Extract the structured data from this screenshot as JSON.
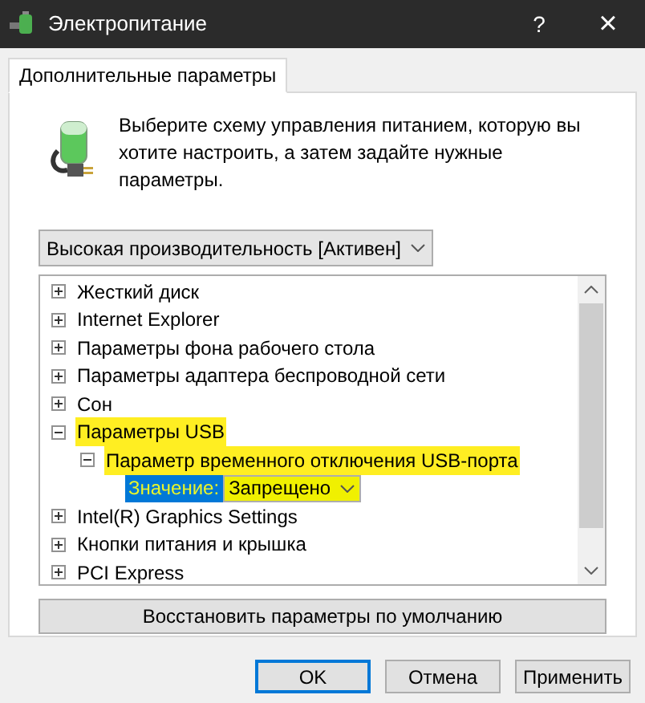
{
  "window": {
    "title": "Электропитание",
    "help": "?",
    "close": "×"
  },
  "tabs": [
    {
      "label": "Дополнительные параметры",
      "selected": true
    }
  ],
  "description": "Выберите схему управления питанием, которую вы хотите настроить, а затем задайте нужные параметры.",
  "plan_dropdown": {
    "value": "Высокая производительность [Активен]"
  },
  "tree": [
    {
      "label": "Жесткий диск",
      "expanded": false,
      "highlighted": false
    },
    {
      "label": "Internet Explorer",
      "expanded": false,
      "highlighted": false
    },
    {
      "label": "Параметры фона рабочего стола",
      "expanded": false,
      "highlighted": false
    },
    {
      "label": "Параметры адаптера беспроводной сети",
      "expanded": false,
      "highlighted": false
    },
    {
      "label": "Сон",
      "expanded": false,
      "highlighted": false
    },
    {
      "label": "Параметры USB",
      "expanded": true,
      "highlighted": true,
      "children": [
        {
          "label": "Параметр временного отключения USB-порта",
          "expanded": true,
          "highlighted": true,
          "children": [
            {
              "kind": "setting",
              "label": "Значение:",
              "value": "Запрещено",
              "selected": true
            }
          ]
        }
      ]
    },
    {
      "label": "Intel(R) Graphics Settings",
      "expanded": false,
      "highlighted": false
    },
    {
      "label": "Кнопки питания и крышка",
      "expanded": false,
      "highlighted": false
    },
    {
      "label": "PCI Express",
      "expanded": false,
      "highlighted": false
    }
  ],
  "restore_button": "Восстановить параметры по умолчанию",
  "buttons": [
    {
      "label": "OK",
      "default": true
    },
    {
      "label": "Отмена",
      "default": false
    },
    {
      "label": "Применить",
      "default": false
    }
  ]
}
